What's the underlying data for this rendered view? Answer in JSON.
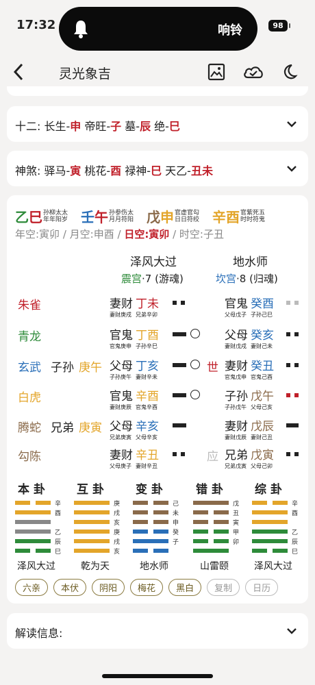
{
  "status": {
    "time": "17:32",
    "notification": "响铃",
    "battery": "98"
  },
  "nav": {
    "title": "灵光象吉"
  },
  "shier": {
    "label": "十二:",
    "items": [
      {
        "a": "长生-",
        "b": "申"
      },
      {
        "a": "帝旺-",
        "b": "子"
      },
      {
        "a": "墓-",
        "b": "辰"
      },
      {
        "a": "绝-",
        "b": "巳"
      }
    ]
  },
  "shensha": {
    "label": "神煞:",
    "items": [
      {
        "a": "驿马-",
        "b": "寅"
      },
      {
        "a": "桃花-",
        "b": "酉"
      },
      {
        "a": "禄神-",
        "b": "巳"
      },
      {
        "a": "天乙-",
        "b": "丑未"
      }
    ]
  },
  "pillars": [
    {
      "gan": "乙",
      "zhi": "巳",
      "c1": "#2e8b3a",
      "c2": "#c0202a",
      "l1": "孙柳太太",
      "l2": "年年阳岁"
    },
    {
      "gan": "壬",
      "zhi": "午",
      "c1": "#2a6fb8",
      "c2": "#c0202a",
      "l1": "孙参伤太",
      "l2": "月月符阳"
    },
    {
      "gan": "戊",
      "zhi": "申",
      "c1": "#8a6a4a",
      "c2": "#e3a52a",
      "l1": "官虚官勾",
      "l2": "日日符绞"
    },
    {
      "gan": "辛",
      "zhi": "酉",
      "c1": "#e3a52a",
      "c2": "#e3a52a",
      "l1": "官紫死五",
      "l2": "时时符鬼"
    }
  ],
  "kong": {
    "year": "年空:寅卯",
    "month": "月空:申酉",
    "day": "日空:寅卯",
    "hour": "时空:子丑",
    "sep": " / "
  },
  "gua": {
    "left": {
      "name": "泽风大过",
      "palace": "震宫",
      "rest": "·7 (游魂)"
    },
    "right": {
      "name": "地水师",
      "palace": "坎宫",
      "rest": "·8 (归魂)"
    }
  },
  "gods": [
    {
      "name": "朱雀",
      "color": "#c0202a"
    },
    {
      "name": "青龙",
      "color": "#2e8b3a"
    },
    {
      "name": "玄武",
      "color": "#2a6fb8"
    },
    {
      "name": "白虎",
      "color": "#e3a52a"
    },
    {
      "name": "腾蛇",
      "color": "#8a6a4a"
    },
    {
      "name": "勾陈",
      "color": "#8a6a4a"
    }
  ],
  "fushen": [
    {
      "rel": "",
      "gz": ""
    },
    {
      "rel": "",
      "gz": ""
    },
    {
      "rel": "子孙",
      "gz": "庚午"
    },
    {
      "rel": "",
      "gz": ""
    },
    {
      "rel": "兄弟",
      "gz": "庚寅"
    },
    {
      "rel": "",
      "gz": ""
    }
  ],
  "leftYao": [
    {
      "rel": "妻财",
      "gz": "丁未",
      "c": "#c0202a",
      "s1": "妻财庚戌",
      "s2": "兄弟辛卯",
      "yang": false,
      "move": false
    },
    {
      "rel": "官鬼",
      "gz": "丁酉",
      "c": "#e3a52a",
      "s1": "官鬼庚申",
      "s2": "子孙辛巳",
      "yang": true,
      "move": true
    },
    {
      "rel": "父母",
      "gz": "丁亥",
      "c": "#2a6fb8",
      "s1": "子孙庚午",
      "s2": "妻财辛未",
      "yang": true,
      "move": true,
      "shi": "世"
    },
    {
      "rel": "官鬼",
      "gz": "辛酉",
      "c": "#e3a52a",
      "s1": "妻财庚辰",
      "s2": "官鬼辛酉",
      "yang": true,
      "move": true
    },
    {
      "rel": "父母",
      "gz": "辛亥",
      "c": "#2a6fb8",
      "s1": "兄弟庚寅",
      "s2": "父母辛亥",
      "yang": true,
      "move": false
    },
    {
      "rel": "妻财",
      "gz": "辛丑",
      "c": "#e3a52a",
      "s1": "父母庚子",
      "s2": "妻财辛丑",
      "yang": false,
      "move": false
    }
  ],
  "rightYao": [
    {
      "rel": "官鬼",
      "gz": "癸酉",
      "c": "#2a6fb8",
      "s1": "父母戊子",
      "s2": "子孙己巳",
      "yang": false,
      "dotc": "#bbb"
    },
    {
      "rel": "父母",
      "gz": "癸亥",
      "c": "#2a6fb8",
      "s1": "妻财戊戌",
      "s2": "妻财己未",
      "yang": false,
      "dotc": "#222"
    },
    {
      "rel": "妻财",
      "gz": "癸丑",
      "c": "#2a6fb8",
      "s1": "官鬼戊申",
      "s2": "官鬼己酉",
      "yang": false,
      "dotc": "#222"
    },
    {
      "rel": "子孙",
      "gz": "戊午",
      "c": "#8a6a4a",
      "s1": "子孙戊午",
      "s2": "父母己亥",
      "yang": false,
      "dotc": "#c0202a"
    },
    {
      "rel": "妻财",
      "gz": "戊辰",
      "c": "#8a6a4a",
      "s1": "妻财戊辰",
      "s2": "妻财己丑",
      "yang": true,
      "dotc": "#222"
    },
    {
      "rel": "兄弟",
      "gz": "戊寅",
      "c": "#8a6a4a",
      "s1": "兄弟戊寅",
      "s2": "父母己卯",
      "yang": false,
      "dotc": "#222",
      "ying": "应"
    }
  ],
  "hexes": [
    {
      "title": "本卦",
      "name": "泽风大过",
      "lines": [
        {
          "t": "yin",
          "c": "#e3a52a",
          "tag": "辛"
        },
        {
          "t": "yang",
          "c": "#e3a52a",
          "tag": "酉"
        },
        {
          "t": "yang",
          "c": "#888",
          "tag": ""
        },
        {
          "t": "yang",
          "c": "#888",
          "tag": "乙"
        },
        {
          "t": "yang",
          "c": "#2e8b3a",
          "tag": "辰"
        },
        {
          "t": "yin",
          "c": "#2e8b3a",
          "tag": "巳"
        }
      ]
    },
    {
      "title": "互卦",
      "name": "乾为天",
      "lines": [
        {
          "t": "yang",
          "c": "#e3a52a",
          "tag": "庚"
        },
        {
          "t": "yang",
          "c": "#e3a52a",
          "tag": "戌"
        },
        {
          "t": "yang",
          "c": "#e3a52a",
          "tag": "亥"
        },
        {
          "t": "yang",
          "c": "#e3a52a",
          "tag": "庚"
        },
        {
          "t": "yang",
          "c": "#e3a52a",
          "tag": "戌"
        },
        {
          "t": "yang",
          "c": "#e3a52a",
          "tag": "亥"
        }
      ]
    },
    {
      "title": "变卦",
      "name": "地水师",
      "lines": [
        {
          "t": "yin",
          "c": "#8a6a4a",
          "tag": "己"
        },
        {
          "t": "yin",
          "c": "#8a6a4a",
          "tag": "未"
        },
        {
          "t": "yin",
          "c": "#8a6a4a",
          "tag": "申"
        },
        {
          "t": "yin",
          "c": "#2a6fb8",
          "tag": "癸"
        },
        {
          "t": "yang",
          "c": "#2a6fb8",
          "tag": "子"
        },
        {
          "t": "yin",
          "c": "#2a6fb8",
          "tag": ""
        }
      ]
    },
    {
      "title": "错卦",
      "name": "山雷颐",
      "lines": [
        {
          "t": "yang",
          "c": "#8a6a4a",
          "tag": "戊"
        },
        {
          "t": "yin",
          "c": "#8a6a4a",
          "tag": "丑"
        },
        {
          "t": "yin",
          "c": "#8a6a4a",
          "tag": "寅"
        },
        {
          "t": "yin",
          "c": "#2e8b3a",
          "tag": "甲"
        },
        {
          "t": "yin",
          "c": "#2e8b3a",
          "tag": "卯"
        },
        {
          "t": "yang",
          "c": "#2e8b3a",
          "tag": ""
        }
      ]
    },
    {
      "title": "综卦",
      "name": "泽风大过",
      "lines": [
        {
          "t": "yin",
          "c": "#e3a52a",
          "tag": "辛"
        },
        {
          "t": "yang",
          "c": "#e3a52a",
          "tag": "酉"
        },
        {
          "t": "yang",
          "c": "#e3a52a",
          "tag": ""
        },
        {
          "t": "yang",
          "c": "#2e8b3a",
          "tag": "乙"
        },
        {
          "t": "yang",
          "c": "#2e8b3a",
          "tag": "辰"
        },
        {
          "t": "yin",
          "c": "#2e8b3a",
          "tag": "巳"
        }
      ]
    }
  ],
  "buttons": [
    {
      "label": "六亲",
      "on": true
    },
    {
      "label": "本伏",
      "on": true
    },
    {
      "label": "阴阳",
      "on": true
    },
    {
      "label": "梅花",
      "on": true
    },
    {
      "label": "黑白",
      "on": true
    },
    {
      "label": "复制",
      "on": false
    },
    {
      "label": "日历",
      "on": false
    }
  ],
  "jiedu": {
    "label": "解读信息:"
  }
}
